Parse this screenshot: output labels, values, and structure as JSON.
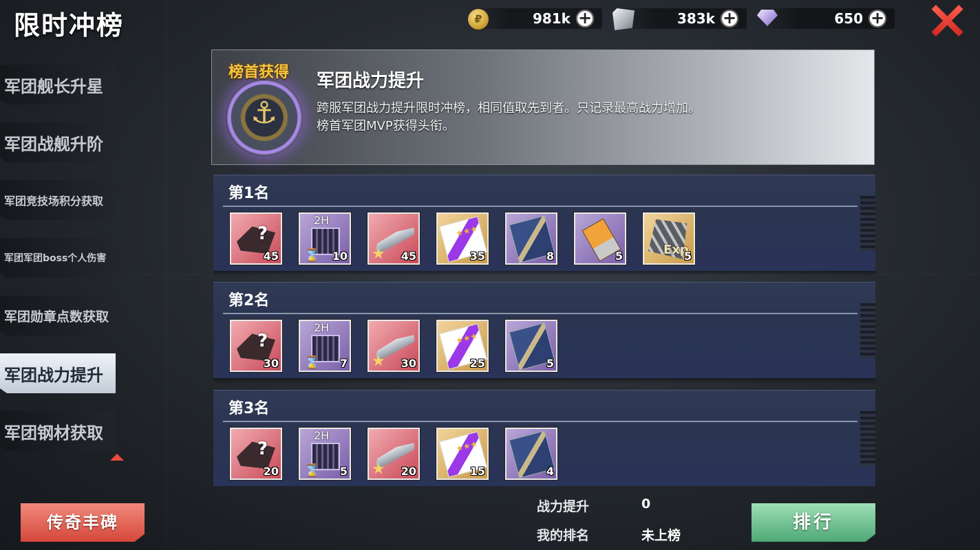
{
  "page_title": "限时冲榜",
  "currencies": [
    {
      "icon": "gold-coin-icon",
      "value": "981k"
    },
    {
      "icon": "steel-icon",
      "value": "383k"
    },
    {
      "icon": "diamond-icon",
      "value": "650"
    }
  ],
  "sidebar": {
    "items": [
      {
        "label": "军团舰长升星",
        "active": false
      },
      {
        "label": "军团战舰升阶",
        "active": false
      },
      {
        "label": "军团竞技场积分获取",
        "active": false
      },
      {
        "label": "军团军团boss个人伤害",
        "active": false
      },
      {
        "label": "军团勋章点数获取",
        "active": false
      },
      {
        "label": "军团战力提升",
        "active": true
      },
      {
        "label": "军团钢材获取",
        "active": false
      }
    ]
  },
  "legend_button": "传奇丰碑",
  "header": {
    "badge_label": "榜首获得",
    "title": "军团战力提升",
    "desc_line1": "跨服军团战力提升限时冲榜，相同值取先到者。只记录最高战力增加。",
    "desc_line2": "榜首军团MVP获得头衔。"
  },
  "ranks": [
    {
      "label": "第1名",
      "rewards": [
        {
          "icon": "mystery-ship-fragment-icon",
          "qty": "45"
        },
        {
          "icon": "time-chest-2h-icon",
          "badge": "2H",
          "qty": "10"
        },
        {
          "icon": "ship-fragment-icon",
          "qty": "45"
        },
        {
          "icon": "recruit-card-icon",
          "qty": "35"
        },
        {
          "icon": "blueprint-icon",
          "qty": "8"
        },
        {
          "icon": "chip-icon",
          "qty": "5"
        },
        {
          "icon": "exp-ammo-icon",
          "badge": "Exp",
          "qty": "5"
        }
      ]
    },
    {
      "label": "第2名",
      "rewards": [
        {
          "icon": "mystery-ship-fragment-icon",
          "qty": "30"
        },
        {
          "icon": "time-chest-2h-icon",
          "badge": "2H",
          "qty": "7"
        },
        {
          "icon": "ship-fragment-icon",
          "qty": "30"
        },
        {
          "icon": "recruit-card-icon",
          "qty": "25"
        },
        {
          "icon": "blueprint-icon",
          "qty": "5"
        }
      ]
    },
    {
      "label": "第3名",
      "rewards": [
        {
          "icon": "mystery-ship-fragment-icon",
          "qty": "20"
        },
        {
          "icon": "time-chest-2h-icon",
          "badge": "2H",
          "qty": "5"
        },
        {
          "icon": "ship-fragment-icon",
          "qty": "20"
        },
        {
          "icon": "recruit-card-icon",
          "qty": "15"
        },
        {
          "icon": "blueprint-icon",
          "qty": "4"
        }
      ]
    }
  ],
  "stats": {
    "power_label": "战力提升",
    "power_value": "0",
    "rank_label": "我的排名",
    "rank_value": "未上榜"
  },
  "ranking_button": "排行",
  "colors": {
    "accent_red": "#d5473a",
    "accent_green": "#4fa876",
    "gold_text": "#f5c542"
  }
}
